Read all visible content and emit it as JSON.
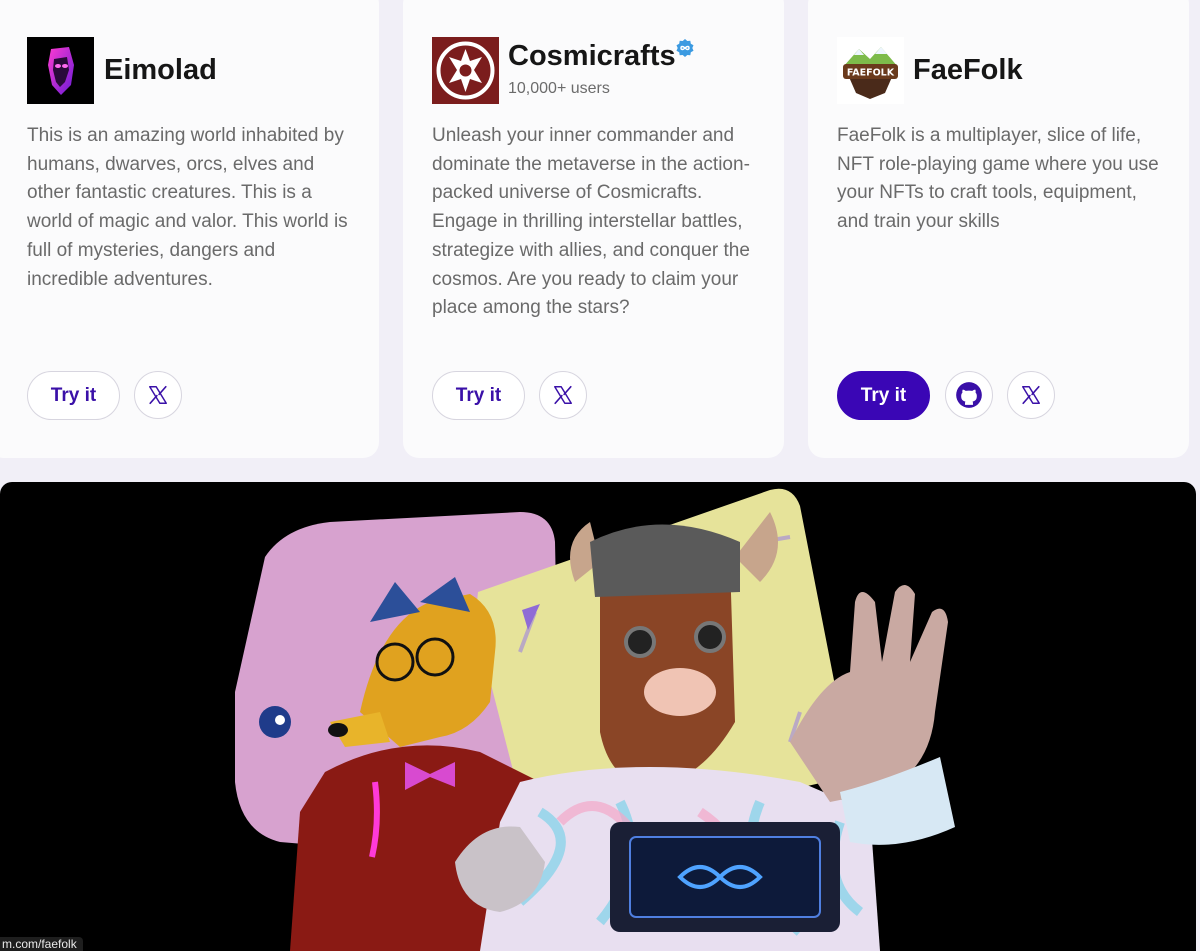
{
  "colors": {
    "page_bg": "#f1eff7",
    "card_bg": "#fbfbfc",
    "accent": "#3a06b5",
    "verified": "#3b9ae1"
  },
  "cards": [
    {
      "title": "Eimolad",
      "description": "This is an amazing world inhabited by humans, dwarves, orcs, elves and other fantastic creatures. This is a world of magic and valor. This world is full of mysteries, dangers and incredible adventures.",
      "try_label": "Try it",
      "icons": [
        "x-icon"
      ]
    },
    {
      "title": "Cosmicrafts",
      "users": "10,000+ users",
      "verified": true,
      "description": "Unleash your inner commander and dominate the metaverse in the action-packed universe of Cosmicrafts. Engage in thrilling interstellar battles, strategize with allies, and conquer the cosmos. Are you ready to claim your place among the stars?",
      "try_label": "Try it",
      "icons": [
        "x-icon"
      ]
    },
    {
      "title": "FaeFolk",
      "logo_text": "FAEFOLK",
      "description": "FaeFolk is a multiplayer, slice of life, NFT role-playing game where you use your NFTs to craft tools, equipment, and train your skills",
      "try_label": "Try it",
      "try_style": "primary",
      "icons": [
        "github-icon",
        "x-icon"
      ]
    }
  ],
  "status_bar": {
    "url": "m.com/faefolk"
  }
}
